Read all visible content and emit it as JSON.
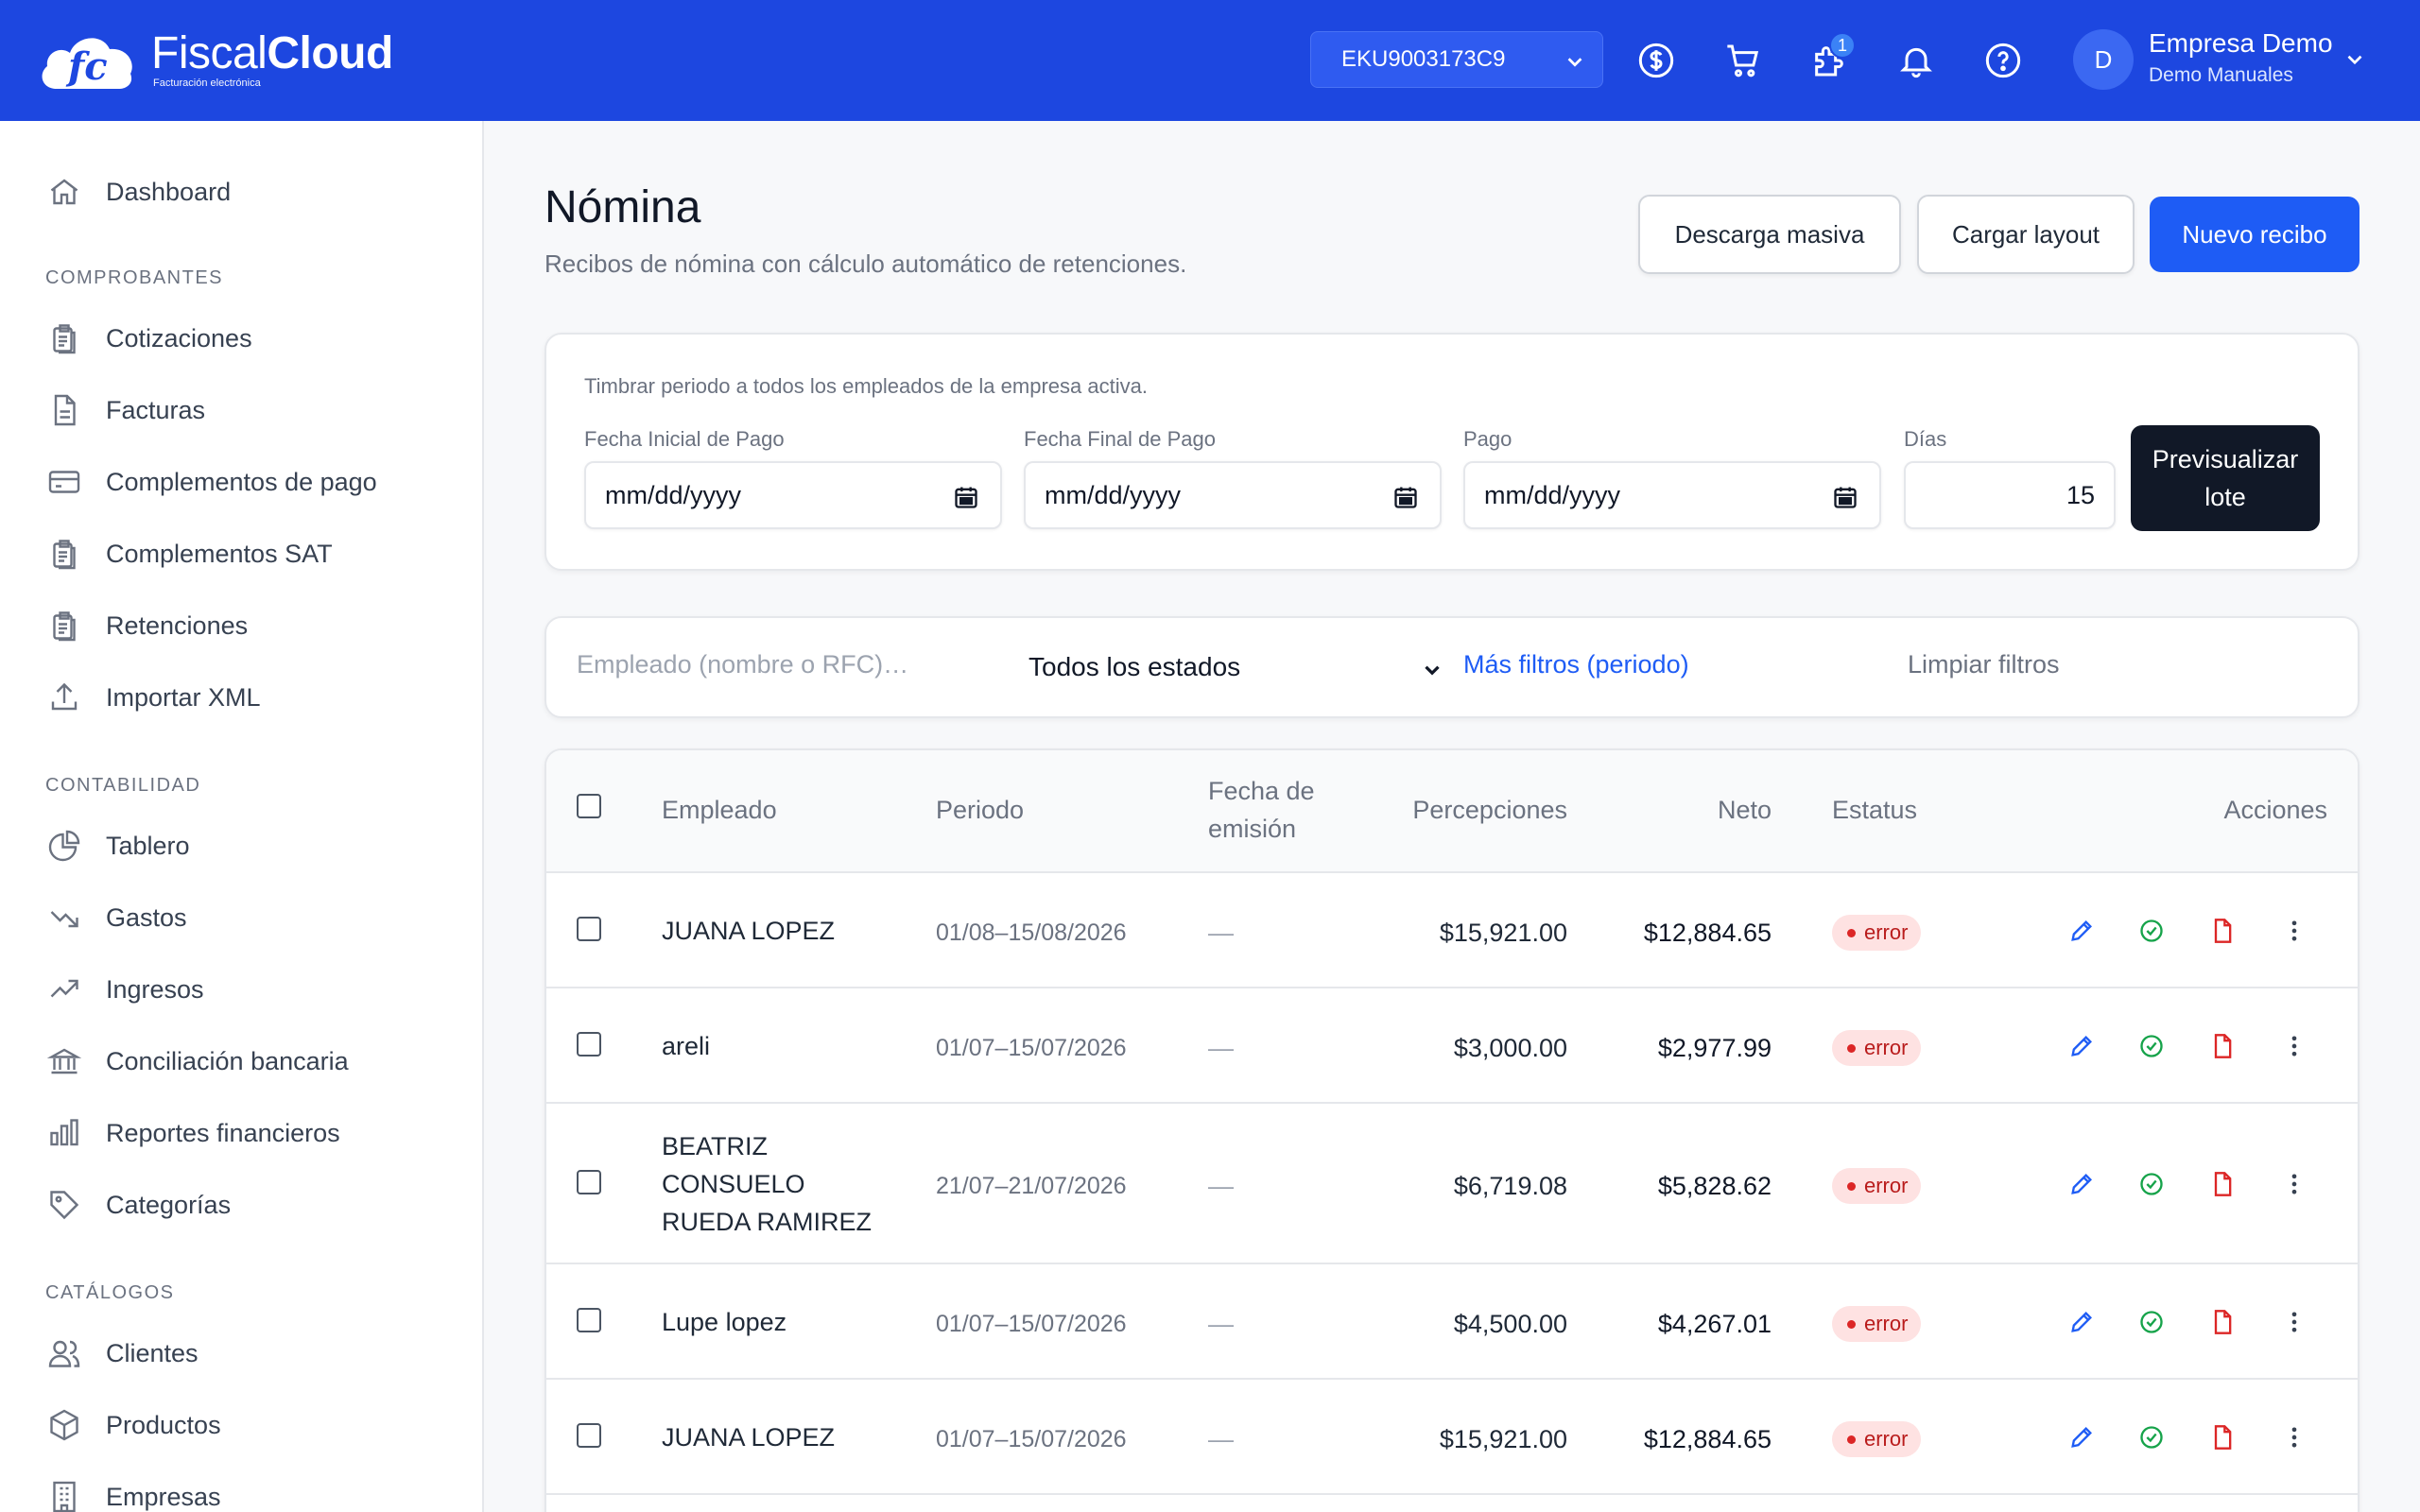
{
  "brand": {
    "name_light": "Fiscal",
    "name_bold": "Cloud",
    "tagline": "Facturación electrónica",
    "mark": "fc"
  },
  "header": {
    "rfc_selected": "EKU9003173C9",
    "cart_badge": "1",
    "user": {
      "avatar_initial": "D",
      "name": "Empresa Demo",
      "subtitle": "Demo Manuales"
    }
  },
  "sidebar": {
    "dashboard": "Dashboard",
    "sections": {
      "comprobantes": "COMPROBANTES",
      "contabilidad": "CONTABILIDAD",
      "catalogos": "CATÁLOGOS"
    },
    "comprobantes": [
      "Cotizaciones",
      "Facturas",
      "Complementos de pago",
      "Complementos SAT",
      "Retenciones",
      "Importar XML"
    ],
    "contabilidad": [
      "Tablero",
      "Gastos",
      "Ingresos",
      "Conciliación bancaria",
      "Reportes financieros",
      "Categorías"
    ],
    "catalogos": [
      "Clientes",
      "Productos",
      "Empresas"
    ]
  },
  "page": {
    "title": "Nómina",
    "subtitle": "Recibos de nómina con cálculo automático de retenciones.",
    "actions": {
      "bulk_download": "Descarga masiva",
      "upload_layout": "Cargar layout",
      "new_receipt": "Nuevo recibo"
    }
  },
  "batch": {
    "note": "Timbrar periodo a todos los empleados de la empresa activa.",
    "start_label": "Fecha Inicial de Pago",
    "start_value": "mm/dd/yyyy",
    "end_label": "Fecha Final de Pago",
    "end_value": "mm/dd/yyyy",
    "pay_label": "Pago",
    "pay_value": "mm/dd/yyyy",
    "days_label": "Días",
    "days_value": "15",
    "preview_button": "Previsualizar lote"
  },
  "filters": {
    "search_placeholder": "Empleado (nombre o RFC)…",
    "status_selected": "Todos los estados",
    "more_filters": "Más filtros (periodo)",
    "clear": "Limpiar filtros"
  },
  "table": {
    "headers": {
      "employee": "Empleado",
      "period": "Periodo",
      "issue_date_1": "Fecha de",
      "issue_date_2": "emisión",
      "perceptions": "Percepciones",
      "net": "Neto",
      "status": "Estatus",
      "actions": "Acciones"
    },
    "rows": [
      {
        "employee": [
          "JUANA LOPEZ"
        ],
        "period": "01/08–15/08/2026",
        "issue_date": "—",
        "perceptions": "$15,921.00",
        "net": "$12,884.65",
        "status": "error"
      },
      {
        "employee": [
          "areli"
        ],
        "period": "01/07–15/07/2026",
        "issue_date": "—",
        "perceptions": "$3,000.00",
        "net": "$2,977.99",
        "status": "error"
      },
      {
        "employee": [
          "BEATRIZ",
          "CONSUELO",
          "RUEDA RAMIREZ"
        ],
        "period": "21/07–21/07/2026",
        "issue_date": "—",
        "perceptions": "$6,719.08",
        "net": "$5,828.62",
        "status": "error"
      },
      {
        "employee": [
          "Lupe lopez"
        ],
        "period": "01/07–15/07/2026",
        "issue_date": "—",
        "perceptions": "$4,500.00",
        "net": "$4,267.01",
        "status": "error"
      },
      {
        "employee": [
          "JUANA LOPEZ"
        ],
        "period": "01/07–15/07/2026",
        "issue_date": "—",
        "perceptions": "$15,921.00",
        "net": "$12,884.65",
        "status": "error"
      }
    ]
  },
  "colors": {
    "brand": "#1d47e0",
    "primary": "#1e5cf5",
    "danger": "#dc2626",
    "success": "#16a34a"
  }
}
